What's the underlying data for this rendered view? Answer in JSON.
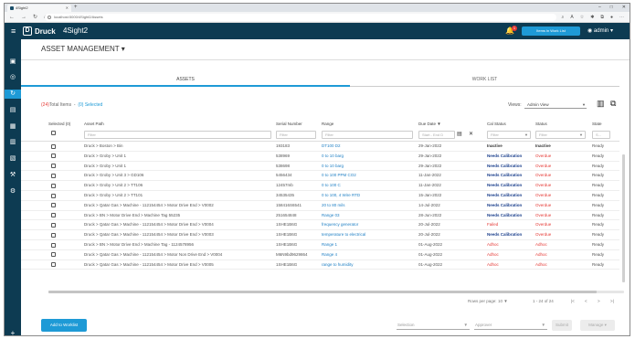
{
  "browser": {
    "tab_title": "4Sight2",
    "url": "localhost:5000/4Sight2/Assets"
  },
  "header": {
    "brand": "Druck",
    "app_name": "4Sight2",
    "notification_count": "1",
    "items_button": "Items in Work List",
    "user": "admin"
  },
  "page": {
    "title": "ASSET MANAGEMENT"
  },
  "tabs": [
    {
      "label": "ASSETS",
      "active": true
    },
    {
      "label": "WORK LIST",
      "active": false
    }
  ],
  "summary": {
    "total_count": "(24)",
    "total_label": "Total Items",
    "selected": "(0) Selected"
  },
  "views": {
    "label": "Views:",
    "selected": "Admin View"
  },
  "table": {
    "columns": {
      "selected": "Selected (0)",
      "asset_path": "Asset Path",
      "serial_number": "Serial Number",
      "range": "Range",
      "due_date": "Due Date",
      "cal_status": "Cal Status",
      "status": "Status",
      "state": "State"
    },
    "filters": {
      "asset_path": "Filter",
      "serial_number": "Filter",
      "range": "Filter",
      "due_date_start": "Start - End D",
      "cal_status": "Filter",
      "status": "Filter",
      "state": "S..."
    },
    "rows": [
      {
        "asset_path": "Druck > Boston > Bin",
        "serial": "193183",
        "range": "DT100 D2",
        "due": "29-Jan-2022",
        "cal_status": "Inactive",
        "cal_class": "dark",
        "status": "Inactive",
        "status_class": "dark",
        "state": "Ready"
      },
      {
        "asset_path": "Druck > Groby > Unit 1",
        "serial": "538969",
        "range": "0 to 10 barg",
        "due": "29-Jan-2022",
        "cal_status": "Needs Calibration",
        "cal_class": "blue",
        "status": "Overdue",
        "status_class": "red",
        "state": "Ready"
      },
      {
        "asset_path": "Druck > Groby > Unit 1",
        "serial": "538698",
        "range": "0 to 10 barg",
        "due": "29-Jan-2022",
        "cal_status": "Needs Calibration",
        "cal_class": "blue",
        "status": "Overdue",
        "status_class": "red",
        "state": "Ready"
      },
      {
        "asset_path": "Druck > Groby > Unit 3 > GD106",
        "serial": "5456434",
        "range": "0 to 100 PPM CO2",
        "due": "11-Jan-2022",
        "cal_status": "Needs Calibration",
        "cal_class": "blue",
        "status": "Overdue",
        "status_class": "red",
        "state": "Ready"
      },
      {
        "asset_path": "Druck > Groby > Unit 2 > TT106",
        "serial": "12457mb",
        "range": "0 to 100 C",
        "due": "11-Jan-2022",
        "cal_status": "Needs Calibration",
        "cal_class": "blue",
        "status": "Overdue",
        "status_class": "red",
        "state": "Ready"
      },
      {
        "asset_path": "Druck > Groby > Unit 2 > TT101",
        "serial": "34535435",
        "range": "0 to 100, 4 Wire RTD",
        "due": "15-Jan-2022",
        "cal_status": "Needs Calibration",
        "cal_class": "blue",
        "status": "Overdue",
        "status_class": "red",
        "state": "Ready"
      },
      {
        "asset_path": "Druck > Qatar Gas > Machine - 112154454 > Motor Drive End > V0002",
        "serial": "158416S6541",
        "range": "20 to 80 mils",
        "due": "14-Jul-2022",
        "cal_status": "Needs Calibration",
        "cal_class": "blue",
        "status": "Overdue",
        "status_class": "red",
        "state": "Ready"
      },
      {
        "asset_path": "Druck > BN > Motor Drive End > Machine Tag 55235",
        "serial": "251654848",
        "range": "Range 03",
        "due": "28-Jun-2022",
        "cal_status": "Needs Calibration",
        "cal_class": "blue",
        "status": "Overdue",
        "status_class": "red",
        "state": "Ready"
      },
      {
        "asset_path": "Druck > Qatar Gas > Machine - 112154454 > Motor Drive End > V0004",
        "serial": "1SHE1B6G",
        "range": "frequency generator",
        "due": "20-Jul-2022",
        "cal_status": "Failed",
        "cal_class": "red",
        "status": "Overdue",
        "status_class": "red",
        "state": "Ready"
      },
      {
        "asset_path": "Druck > Qatar Gas > Machine - 112154454 > Motor Drive End > V0003",
        "serial": "1SHE1B6G",
        "range": "temperature to electrical",
        "due": "20-Jul-2022",
        "cal_status": "Needs Calibration",
        "cal_class": "blue",
        "status": "Overdue",
        "status_class": "red",
        "state": "Ready"
      },
      {
        "asset_path": "Druck > BN > Motor Drive End > Machine Tag - 1124578956",
        "serial": "1SHE1B6G",
        "range": "Range 1",
        "due": "01-Aug-2022",
        "cal_status": "Adhoc",
        "cal_class": "red",
        "status": "Adhoc",
        "status_class": "red",
        "state": "Ready"
      },
      {
        "asset_path": "Druck > Qatar Gas > Machine - 112154454 > Motor Non Drive End > V0004",
        "serial": "M6N9bd9629864",
        "range": "Range 4",
        "due": "01-Aug-2022",
        "cal_status": "Adhoc",
        "cal_class": "red",
        "status": "Adhoc",
        "status_class": "red",
        "state": "Ready"
      },
      {
        "asset_path": "Druck > Qatar Gas > Machine - 112154454 > Motor Drive End > V0005",
        "serial": "1SHE1B6G",
        "range": "range to humidity",
        "due": "01-Aug-2022",
        "cal_status": "Adhoc",
        "cal_class": "red",
        "status": "Adhoc",
        "status_class": "red",
        "state": "Ready"
      }
    ]
  },
  "pager": {
    "rows_per_page_label": "Rows per page:",
    "rows_per_page": "10",
    "range_text": "1 - 24 of 24"
  },
  "footer": {
    "add_to_worklist": "Add to Worklist",
    "selection_placeholder": "Selection",
    "approver_placeholder": "Approver",
    "submit": "Submit",
    "manage": "Manage"
  },
  "colors": {
    "header_bg": "#0d3b52",
    "accent": "#1e9ad6",
    "danger": "#e53935",
    "cal_blue": "#1b3f8c",
    "link": "#1e7fc4"
  }
}
